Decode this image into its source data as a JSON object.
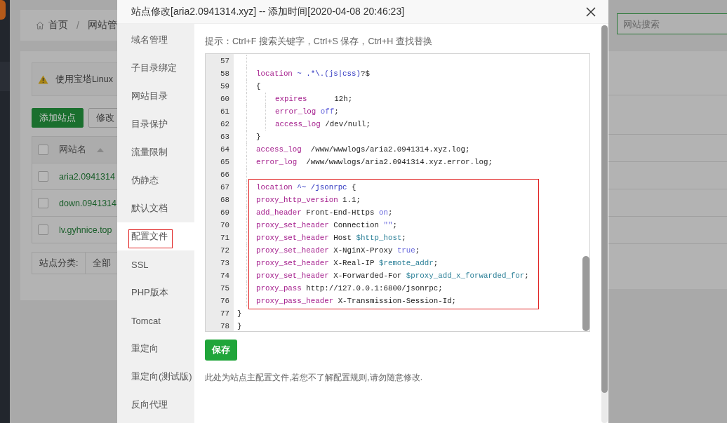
{
  "background": {
    "breadcrumb": {
      "home": "首页",
      "separator": "/",
      "current": "网站管"
    },
    "alert": "使用宝塔Linux",
    "buttons": [
      {
        "label": "添加站点",
        "kind": "primary"
      },
      {
        "label": "修改",
        "kind": "default"
      }
    ],
    "table": {
      "header": {
        "label": "网站名",
        "checked": false
      },
      "rows": [
        {
          "name": "aria2.0941314",
          "checked": false
        },
        {
          "name": "down.0941314",
          "checked": false
        },
        {
          "name": "lv.gyhnice.top",
          "checked": false
        }
      ]
    },
    "category": {
      "label": "站点分类:",
      "value": "全部"
    },
    "search": {
      "placeholder": "网站搜索"
    }
  },
  "dialog": {
    "title": "站点修改[aria2.0941314.xyz] -- 添加时间[2020-04-08 20:46:23]",
    "tabs": [
      {
        "label": "域名管理",
        "selected": false,
        "annotated": false
      },
      {
        "label": "子目录绑定",
        "selected": false,
        "annotated": false
      },
      {
        "label": "网站目录",
        "selected": false,
        "annotated": false
      },
      {
        "label": "目录保护",
        "selected": false,
        "annotated": false
      },
      {
        "label": "流量限制",
        "selected": false,
        "annotated": false
      },
      {
        "label": "伪静态",
        "selected": false,
        "annotated": false
      },
      {
        "label": "默认文档",
        "selected": false,
        "annotated": false
      },
      {
        "label": "配置文件",
        "selected": true,
        "annotated": true
      },
      {
        "label": "SSL",
        "selected": false,
        "annotated": false
      },
      {
        "label": "PHP版本",
        "selected": false,
        "annotated": false
      },
      {
        "label": "Tomcat",
        "selected": false,
        "annotated": false
      },
      {
        "label": "重定向",
        "selected": false,
        "annotated": false
      },
      {
        "label": "重定向(测试版)",
        "selected": false,
        "annotated": false
      },
      {
        "label": "反向代理",
        "selected": false,
        "annotated": false
      }
    ],
    "hint": "提示：Ctrl+F 搜索关键字，Ctrl+S 保存，Ctrl+H 查找替换",
    "code": [
      {
        "n": "57",
        "kind": "block"
      },
      {
        "n": "58",
        "kind": "block",
        "tokens": [
          {
            "t": "location",
            "kind": "keyword"
          },
          {
            "t": " ~ .*\\.(js|css)",
            "kind": "operator"
          },
          {
            "t": "?$",
            "kind": "plain"
          }
        ]
      },
      {
        "n": "59",
        "kind": "block",
        "tokens": [
          {
            "t": "{",
            "kind": "plain"
          }
        ]
      },
      {
        "n": "60",
        "kind": "nested",
        "tokens": [
          {
            "t": "expires",
            "kind": "keyword"
          },
          {
            "t": "      12h;",
            "kind": "plain"
          }
        ]
      },
      {
        "n": "61",
        "kind": "nested",
        "tokens": [
          {
            "t": "error_log",
            "kind": "keyword"
          },
          {
            "t": " off",
            "kind": "value"
          },
          {
            "t": ";",
            "kind": "plain"
          }
        ]
      },
      {
        "n": "62",
        "kind": "nested",
        "tokens": [
          {
            "t": "access_log",
            "kind": "keyword"
          },
          {
            "t": " /dev/null;",
            "kind": "plain"
          }
        ]
      },
      {
        "n": "63",
        "kind": "block",
        "tokens": [
          {
            "t": "}",
            "kind": "plain"
          }
        ]
      },
      {
        "n": "64",
        "kind": "block",
        "tokens": [
          {
            "t": "access_log",
            "kind": "keyword"
          },
          {
            "t": "  /www/wwwlogs/aria2.0941314.xyz.log;",
            "kind": "plain"
          }
        ]
      },
      {
        "n": "65",
        "kind": "block",
        "tokens": [
          {
            "t": "error_log",
            "kind": "keyword"
          },
          {
            "t": "  /www/wwwlogs/aria2.0941314.xyz.error.log;",
            "kind": "plain"
          }
        ]
      },
      {
        "n": "66",
        "kind": "block"
      },
      {
        "kind": "frame",
        "lines": [
          {
            "n": "67",
            "kind": "block",
            "tokens": [
              {
                "t": "location",
                "kind": "keyword"
              },
              {
                "t": " ^~ /jsonrpc",
                "kind": "operator"
              },
              {
                "t": " {",
                "kind": "plain"
              }
            ]
          },
          {
            "n": "68",
            "kind": "block",
            "tokens": [
              {
                "t": "proxy_http_version",
                "kind": "keyword"
              },
              {
                "t": " 1.1;",
                "kind": "plain"
              }
            ]
          },
          {
            "n": "69",
            "kind": "block",
            "tokens": [
              {
                "t": "add_header",
                "kind": "keyword"
              },
              {
                "t": " Front-End-Https ",
                "kind": "plain"
              },
              {
                "t": "on",
                "kind": "value"
              },
              {
                "t": ";",
                "kind": "plain"
              }
            ]
          },
          {
            "n": "70",
            "kind": "block",
            "tokens": [
              {
                "t": "proxy_set_header",
                "kind": "keyword"
              },
              {
                "t": " Connection ",
                "kind": "plain"
              },
              {
                "t": "\"\"",
                "kind": "value"
              },
              {
                "t": ";",
                "kind": "plain"
              }
            ]
          },
          {
            "n": "71",
            "kind": "block",
            "tokens": [
              {
                "t": "proxy_set_header",
                "kind": "keyword"
              },
              {
                "t": " Host ",
                "kind": "plain"
              },
              {
                "t": "$http_host",
                "kind": "variable"
              },
              {
                "t": ";",
                "kind": "plain"
              }
            ]
          },
          {
            "n": "72",
            "kind": "block",
            "tokens": [
              {
                "t": "proxy_set_header",
                "kind": "keyword"
              },
              {
                "t": " X-NginX-Proxy ",
                "kind": "plain"
              },
              {
                "t": "true",
                "kind": "value"
              },
              {
                "t": ";",
                "kind": "plain"
              }
            ]
          },
          {
            "n": "73",
            "kind": "block",
            "tokens": [
              {
                "t": "proxy_set_header",
                "kind": "keyword"
              },
              {
                "t": " X-Real-IP ",
                "kind": "plain"
              },
              {
                "t": "$remote_addr",
                "kind": "variable"
              },
              {
                "t": ";",
                "kind": "plain"
              }
            ]
          },
          {
            "n": "74",
            "kind": "block",
            "tokens": [
              {
                "t": "proxy_set_header",
                "kind": "keyword"
              },
              {
                "t": " X-Forwarded-For ",
                "kind": "plain"
              },
              {
                "t": "$proxy_add_x_forwarded_for",
                "kind": "variable"
              },
              {
                "t": ";",
                "kind": "plain"
              }
            ]
          },
          {
            "n": "75",
            "kind": "block",
            "tokens": [
              {
                "t": "proxy_pass",
                "kind": "keyword"
              },
              {
                "t": " http://127.0.0.1:6800/jsonrpc;",
                "kind": "plain"
              }
            ]
          },
          {
            "n": "76",
            "kind": "block",
            "tokens": [
              {
                "t": "proxy_pass_header",
                "kind": "keyword"
              },
              {
                "t": " X-Transmission-Session-Id;",
                "kind": "plain"
              }
            ]
          }
        ]
      },
      {
        "n": "77",
        "kind": "top",
        "tokens": [
          {
            "t": "}",
            "kind": "plain"
          }
        ]
      },
      {
        "n": "78",
        "kind": "top",
        "tokens": [
          {
            "t": "}",
            "kind": "plain"
          }
        ]
      }
    ],
    "save_button": "保存",
    "note": "此处为站点主配置文件,若您不了解配置规则,请勿随意修改."
  }
}
